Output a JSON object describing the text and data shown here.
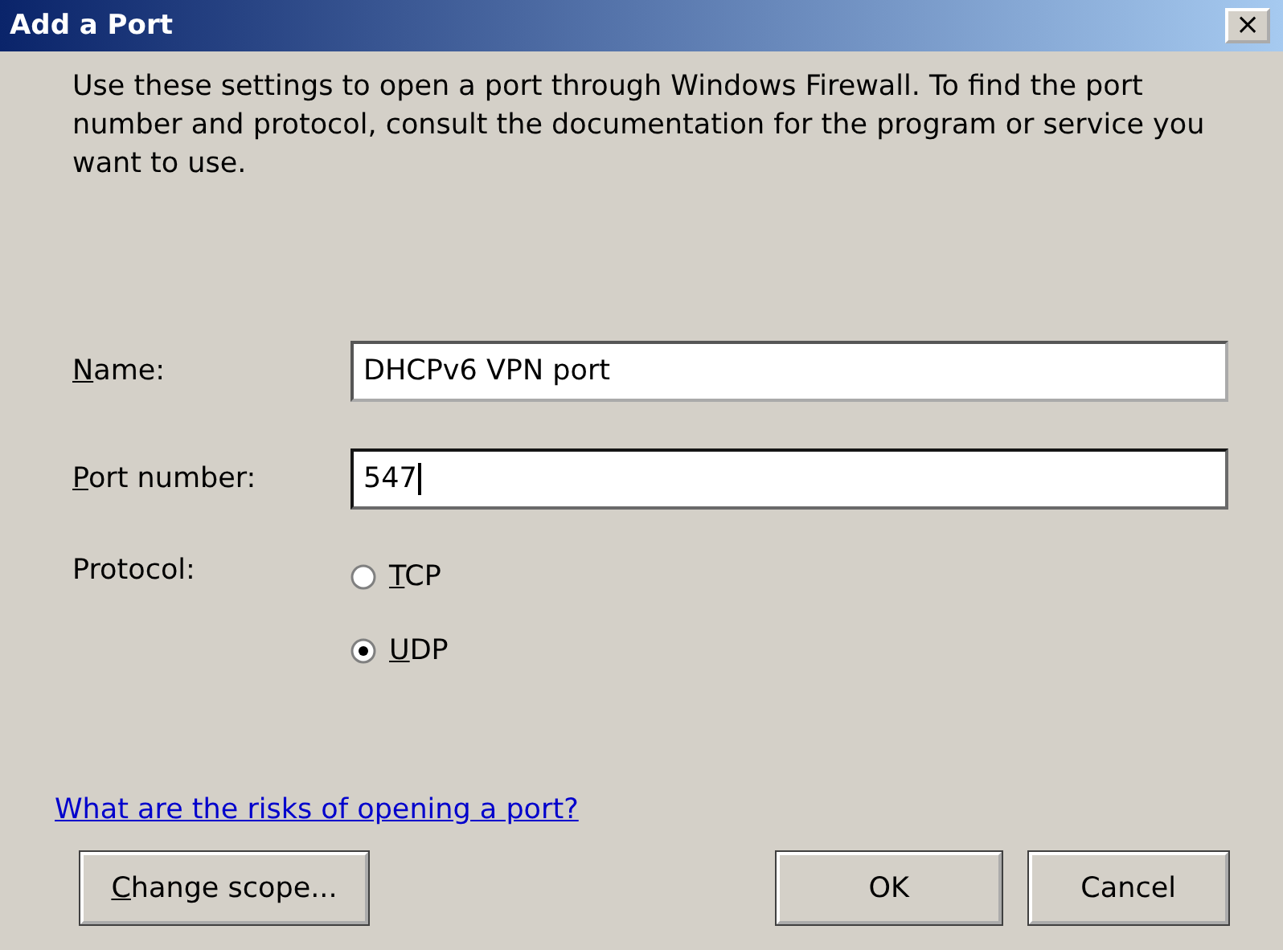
{
  "window": {
    "title": "Add a Port",
    "close": "×"
  },
  "description": "Use these settings to open a port through Windows Firewall. To find the port number and protocol, consult the documentation for the program or service you want to use.",
  "fields": [
    {
      "label": "Name:",
      "mnemonic": true,
      "value": "DHCPv6 VPN port",
      "focused": false
    },
    {
      "label": "Port number:",
      "mnemonic": true,
      "value": "547",
      "focused": true
    }
  ],
  "protocol": {
    "label": "Protocol:",
    "options": [
      {
        "label": "TCP",
        "mnemonic": true,
        "selected": false
      },
      {
        "label": "UDP",
        "mnemonic": true,
        "selected": true
      }
    ]
  },
  "link": "What are the risks of opening a port?",
  "buttons": [
    {
      "label": "Change scope...",
      "mnemonic": true
    },
    {
      "label": "OK",
      "mnemonic": false
    },
    {
      "label": "Cancel",
      "mnemonic": false
    }
  ]
}
